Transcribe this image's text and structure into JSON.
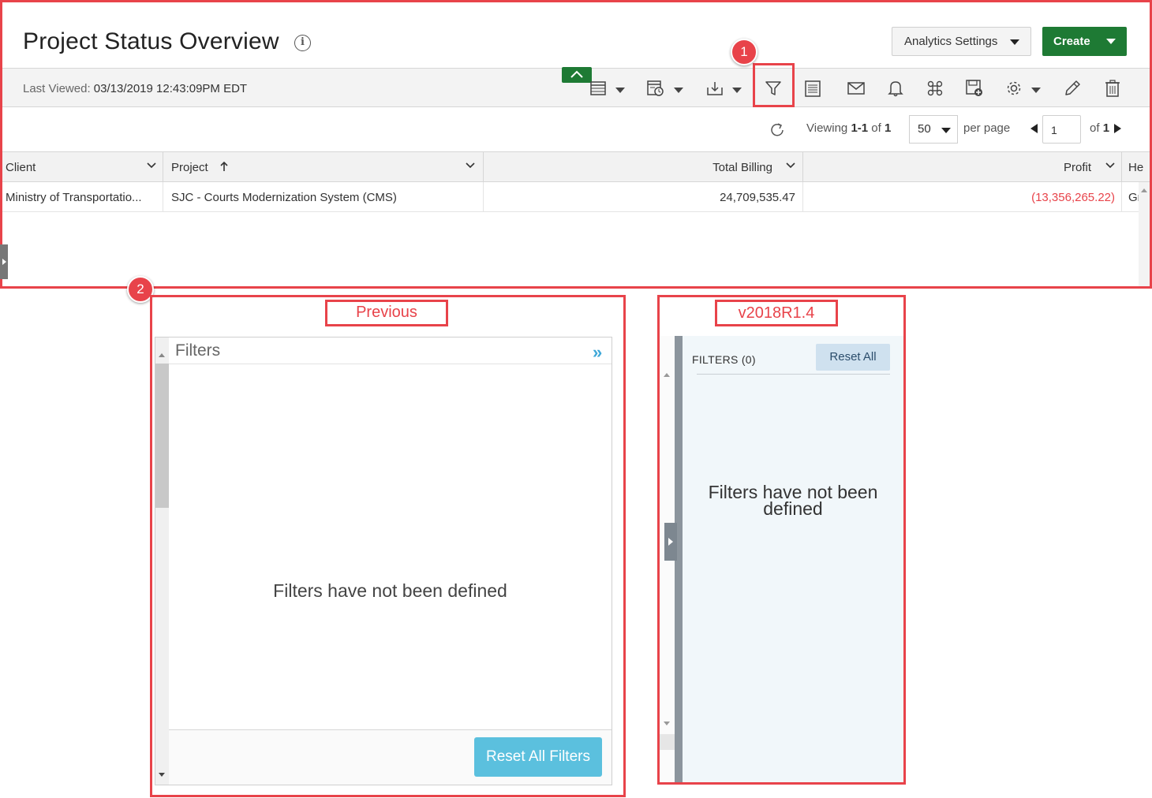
{
  "header": {
    "title": "Project Status Overview",
    "analytics_settings_label": "Analytics Settings",
    "create_label": "Create"
  },
  "toolbar": {
    "last_viewed_label": "Last Viewed:",
    "last_viewed_value": "03/13/2019 12:43:09PM EDT",
    "icons": [
      "grid-view-icon",
      "report-icon",
      "download-icon",
      "filter-icon",
      "notes-icon",
      "email-icon",
      "bell-icon",
      "command-icon",
      "save-icon",
      "gear-icon",
      "pencil-icon",
      "trash-icon"
    ]
  },
  "pager": {
    "viewing_prefix": "Viewing",
    "viewing_range": "1-1",
    "of_label": "of",
    "total": "1",
    "per_page_value": "50",
    "per_page_label": "per page",
    "page_value": "1",
    "page_of_label": "of",
    "page_total": "1"
  },
  "grid": {
    "columns": [
      "Client",
      "Project",
      "Total Billing",
      "Profit",
      "He"
    ],
    "rows": [
      {
        "client": "Ministry of Transportatio...",
        "project": "SJC - Courts Modernization System (CMS)",
        "total_billing": "24,709,535.47",
        "profit": "(13,356,265.22)",
        "extra": "Gr"
      }
    ],
    "negative_color": "#e8434a"
  },
  "annotations": {
    "badge_1": "1",
    "badge_2": "2",
    "label_previous": "Previous",
    "label_new": "v2018R1.4",
    "color": "#e8434a"
  },
  "previous_panel": {
    "title": "Filters",
    "empty_message": "Filters have not been defined",
    "reset_button": "Reset All Filters"
  },
  "new_panel": {
    "title": "FILTERS (0)",
    "reset_button": "Reset All",
    "empty_message": "Filters have not been defined"
  },
  "colors": {
    "brand_green": "#1e7a34",
    "info_blue": "#5bc0de"
  }
}
